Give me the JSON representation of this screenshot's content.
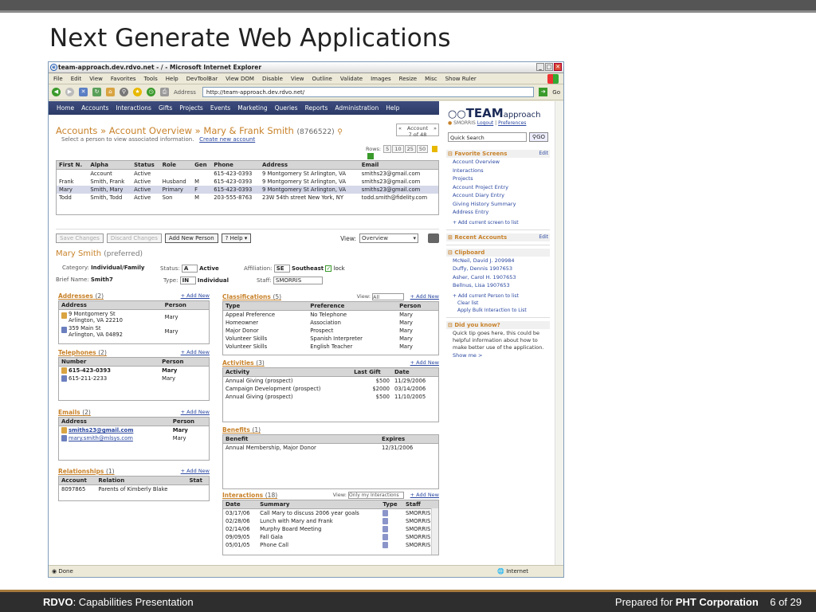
{
  "slide": {
    "title": "Next Generate Web Applications",
    "footer_brand": "RDVO",
    "footer_left": ": Capabilities Presentation",
    "footer_prepared": "Prepared for ",
    "footer_client": "PHT Corporation",
    "footer_page": "6 of 29"
  },
  "browser": {
    "title": "team-approach.dev.rdvo.net - / - Microsoft Internet Explorer",
    "menus": [
      "File",
      "Edit",
      "View",
      "Favorites",
      "Tools",
      "Help",
      "DevToolBar",
      "View DOM",
      "Disable",
      "View",
      "Outline",
      "Validate",
      "Images",
      "Resize",
      "Misc",
      "Show Ruler"
    ],
    "address_label": "Address",
    "address": "http://team-approach.dev.rdvo.net/",
    "go": "Go",
    "status": "Done",
    "zone": "Internet"
  },
  "nav": [
    "Home",
    "Accounts",
    "Interactions",
    "Gifts",
    "Projects",
    "Events",
    "Marketing",
    "Queries",
    "Reports",
    "Administration",
    "Help"
  ],
  "breadcrumb": {
    "a": "Accounts",
    "b": "Account Overview",
    "c": "Mary & Frank Smith",
    "id": "(8766522)",
    "sub": "Select a person to view associated information.",
    "create": "Create new account",
    "acct_label": "Account",
    "acct_pos": "7 of 48"
  },
  "rows_label": "Rows:",
  "rows_opts": [
    "5",
    "10",
    "25",
    "50"
  ],
  "people": {
    "headers": [
      "First N.",
      "Alpha",
      "Status",
      "Role",
      "Gen",
      "Phone",
      "Address",
      "Email"
    ],
    "rows": [
      [
        "",
        "Account",
        "Active",
        "",
        "",
        "615-423-0393",
        "9 Montgomery St Arlington, VA",
        "smiths23@gmail.com"
      ],
      [
        "Frank",
        "Smith, Frank",
        "Active",
        "Husband",
        "M",
        "615-423-0393",
        "9 Montgomery St Arlington, VA",
        "smiths23@gmail.com"
      ],
      [
        "Mary",
        "Smith, Mary",
        "Active",
        "Primary",
        "F",
        "615-423-0393",
        "9 Montgomery St Arlington, VA",
        "smiths23@gmail.com"
      ],
      [
        "Todd",
        "Smith, Todd",
        "Active",
        "Son",
        "M",
        "203-555-8763",
        "23W 54th street New York, NY",
        "todd.smith@fidelity.com"
      ]
    ]
  },
  "actions": {
    "save": "Save Changes",
    "discard": "Discard Changes",
    "add": "Add New Person",
    "help": "Help",
    "view_label": "View:",
    "view_value": "Overview"
  },
  "person": {
    "name": "Mary Smith",
    "pref": "(preferred)",
    "cat_label": "Category:",
    "cat": "Individual/Family",
    "brief_label": "Brief Name:",
    "brief": "Smith7",
    "status_label": "Status:",
    "status_code": "A",
    "status": "Active",
    "type_label": "Type:",
    "type_code": "IN",
    "type": "Individual",
    "aff_label": "Affiliation:",
    "aff_code": "SE",
    "aff": "Southeast",
    "lock": "lock",
    "staff_label": "Staff:",
    "staff": "SMORRIS"
  },
  "addresses": {
    "title": "Addresses",
    "count": "(2)",
    "add": "+ Add New",
    "headers": [
      "Address",
      "Person"
    ],
    "rows": [
      {
        "line1": "9 Montgomery St",
        "line2": "Arlington, VA 22210",
        "person": "Mary",
        "bold": true
      },
      {
        "line1": "359 Main St",
        "line2": "Arlington, VA 04892",
        "person": "Mary",
        "bold": false
      }
    ]
  },
  "telephones": {
    "title": "Telephones",
    "count": "(2)",
    "add": "+ Add New",
    "headers": [
      "Number",
      "Person"
    ],
    "rows": [
      [
        "615-423-0393",
        "Mary"
      ],
      [
        "615-211-2233",
        "Mary"
      ]
    ]
  },
  "emails": {
    "title": "Emails",
    "count": "(2)",
    "add": "+ Add New",
    "headers": [
      "Address",
      "Person"
    ],
    "rows": [
      [
        "smiths23@gmail.com",
        "Mary"
      ],
      [
        "mary.smith@mlsys.com",
        "Mary"
      ]
    ]
  },
  "relationships": {
    "title": "Relationships",
    "count": "(1)",
    "add": "+ Add New",
    "headers": [
      "Account",
      "Relation",
      "Stat"
    ],
    "rows": [
      [
        "8097865",
        "Parents of Kimberly Blake",
        ""
      ]
    ]
  },
  "classifications": {
    "title": "Classifications",
    "count": "(5)",
    "view": "View:",
    "view_value": "All",
    "add": "+ Add New",
    "headers": [
      "Type",
      "Preference",
      "Person"
    ],
    "rows": [
      [
        "Appeal Preference",
        "No Telephone",
        "Mary"
      ],
      [
        "Homeowner",
        "Association",
        "Mary"
      ],
      [
        "Major Donor",
        "Prospect",
        "Mary"
      ],
      [
        "Volunteer Skills",
        "Spanish Interpreter",
        "Mary"
      ],
      [
        "Volunteer Skills",
        "English Teacher",
        "Mary"
      ]
    ]
  },
  "activities": {
    "title": "Activities",
    "count": "(3)",
    "add": "+ Add New",
    "headers": [
      "Activity",
      "Last Gift",
      "Date"
    ],
    "rows": [
      [
        "Annual Giving (prospect)",
        "$500",
        "11/29/2006"
      ],
      [
        "Campaign Development (prospect)",
        "$2000",
        "03/14/2006"
      ],
      [
        "Annual Giving (prospect)",
        "$500",
        "11/10/2005"
      ]
    ]
  },
  "benefits": {
    "title": "Benefits",
    "count": "(1)",
    "headers": [
      "Benefit",
      "Expires"
    ],
    "rows": [
      [
        "Annual Membership, Major Donor",
        "12/31/2006"
      ]
    ]
  },
  "interactions": {
    "title": "Interactions",
    "count": "(18)",
    "view": "View:",
    "view_value": "Only my Interactions",
    "add": "+ Add New",
    "headers": [
      "Date",
      "Summary",
      "Type",
      "Staff"
    ],
    "rows": [
      [
        "03/17/06",
        "Call Mary to discuss 2006 year goals",
        "SMORRIS"
      ],
      [
        "02/28/06",
        "Lunch with Mary and  Frank",
        "SMORRIS"
      ],
      [
        "02/14/06",
        "Murphy Board Meeting",
        "SMORRIS"
      ],
      [
        "09/09/05",
        "Fall Gala",
        "SMORRIS"
      ],
      [
        "05/01/05",
        "Phone Call",
        "SMORRIS"
      ]
    ]
  },
  "sidebar": {
    "logo_a": "TEAM",
    "logo_b": "approach",
    "user": "SMORRIS",
    "logout": "Logout",
    "prefs": "Preferences",
    "search_placeholder": "Quick Search",
    "search_go": "GO",
    "fav_title": "Favorite Screens",
    "edit": "Edit",
    "favs": [
      "Account Overview",
      "Interactions",
      "Projects",
      "Account Project Entry",
      "Account Diary Entry",
      "Giving History Summary",
      "Address Entry"
    ],
    "fav_add": "+ Add current screen to list",
    "recent_title": "Recent Accounts",
    "clip_title": "Clipboard",
    "clips": [
      "McNeil, David J. 209984",
      "Duffy, Dennis 1907653",
      "Asher, Carol H. 1907653",
      "Bellnus, Lisa 1907653"
    ],
    "clip_links": [
      "+ Add current Person to list",
      "Clear list",
      "Apply Bulk Interaction to List"
    ],
    "dyk_title": "Did you know?",
    "dyk_text": "Quick tip goes here, this could be helpful information about how to make better use of the application.",
    "dyk_more": "Show me >"
  }
}
